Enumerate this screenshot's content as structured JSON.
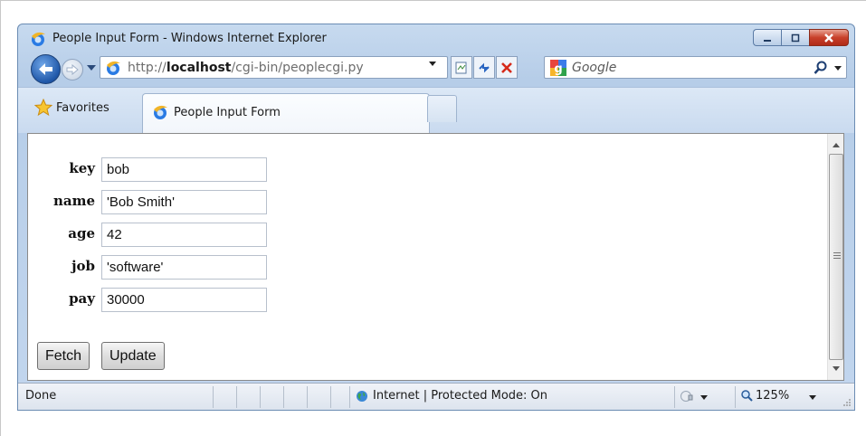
{
  "window": {
    "title": "People Input Form - Windows Internet Explorer"
  },
  "address_bar": {
    "url_prefix": "http://",
    "url_host": "localhost",
    "url_path": "/cgi-bin/peoplecgi.py"
  },
  "search": {
    "placeholder": "Google"
  },
  "favorites": {
    "label": "Favorites"
  },
  "tab": {
    "label": "People Input Form"
  },
  "form": {
    "fields": [
      {
        "label": "key",
        "value": "bob"
      },
      {
        "label": "name",
        "value": "'Bob Smith'"
      },
      {
        "label": "age",
        "value": "42"
      },
      {
        "label": "job",
        "value": "'software'"
      },
      {
        "label": "pay",
        "value": "30000"
      }
    ],
    "fetch_label": "Fetch",
    "update_label": "Update"
  },
  "status": {
    "text": "Done",
    "zone": "Internet | Protected Mode: On",
    "zoom": "125%"
  },
  "icons": {
    "back": "back-arrow-icon",
    "forward": "forward-arrow-icon",
    "refresh": "refresh-icon",
    "stop": "stop-icon",
    "search": "search-icon",
    "favorites": "star-icon"
  }
}
